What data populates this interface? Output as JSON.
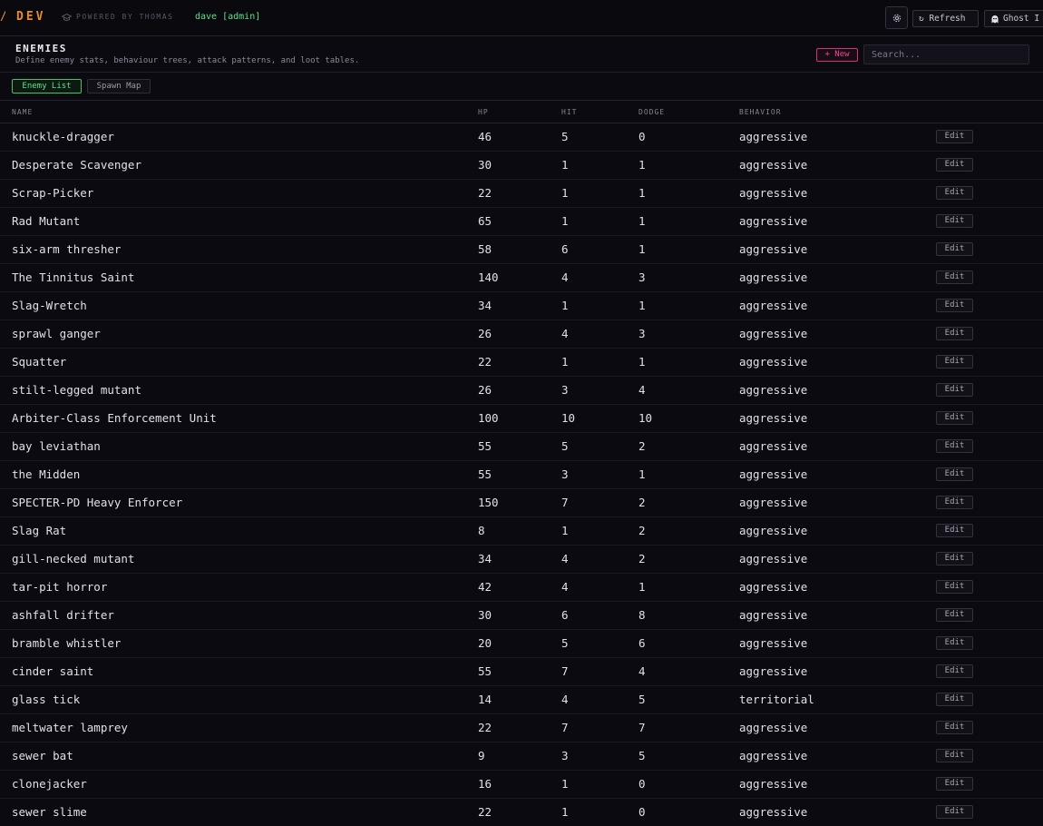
{
  "topbar": {
    "logo_mark": "/",
    "brand": "DEV",
    "powered_by": "POWERED BY THOMAS",
    "user": "dave [admin]",
    "refresh_label": "↻ Refresh",
    "ghost_label": "Ghost I"
  },
  "section": {
    "title": "ENEMIES",
    "description": "Define enemy stats, behaviour trees, attack patterns, and loot tables.",
    "new_label": "+ New",
    "search_placeholder": "Search..."
  },
  "tabs": [
    {
      "label": "Enemy List",
      "active": true
    },
    {
      "label": "Spawn Map",
      "active": false
    }
  ],
  "table": {
    "columns": [
      "NAME",
      "HP",
      "HIT",
      "DODGE",
      "BEHAVIOR"
    ],
    "edit_label": "Edit",
    "rows": [
      {
        "name": "knuckle-dragger",
        "hp": "46",
        "hit": "5",
        "dodge": "0",
        "behavior": "aggressive"
      },
      {
        "name": "Desperate Scavenger",
        "hp": "30",
        "hit": "1",
        "dodge": "1",
        "behavior": "aggressive"
      },
      {
        "name": "Scrap-Picker",
        "hp": "22",
        "hit": "1",
        "dodge": "1",
        "behavior": "aggressive"
      },
      {
        "name": "Rad Mutant",
        "hp": "65",
        "hit": "1",
        "dodge": "1",
        "behavior": "aggressive"
      },
      {
        "name": "six-arm thresher",
        "hp": "58",
        "hit": "6",
        "dodge": "1",
        "behavior": "aggressive"
      },
      {
        "name": "The Tinnitus Saint",
        "hp": "140",
        "hit": "4",
        "dodge": "3",
        "behavior": "aggressive"
      },
      {
        "name": "Slag-Wretch",
        "hp": "34",
        "hit": "1",
        "dodge": "1",
        "behavior": "aggressive"
      },
      {
        "name": "sprawl ganger",
        "hp": "26",
        "hit": "4",
        "dodge": "3",
        "behavior": "aggressive"
      },
      {
        "name": "Squatter",
        "hp": "22",
        "hit": "1",
        "dodge": "1",
        "behavior": "aggressive"
      },
      {
        "name": "stilt-legged mutant",
        "hp": "26",
        "hit": "3",
        "dodge": "4",
        "behavior": "aggressive"
      },
      {
        "name": "Arbiter-Class Enforcement Unit",
        "hp": "100",
        "hit": "10",
        "dodge": "10",
        "behavior": "aggressive"
      },
      {
        "name": "bay leviathan",
        "hp": "55",
        "hit": "5",
        "dodge": "2",
        "behavior": "aggressive"
      },
      {
        "name": "the Midden",
        "hp": "55",
        "hit": "3",
        "dodge": "1",
        "behavior": "aggressive"
      },
      {
        "name": "SPECTER-PD Heavy Enforcer",
        "hp": "150",
        "hit": "7",
        "dodge": "2",
        "behavior": "aggressive"
      },
      {
        "name": "Slag Rat",
        "hp": "8",
        "hit": "1",
        "dodge": "2",
        "behavior": "aggressive"
      },
      {
        "name": "gill-necked mutant",
        "hp": "34",
        "hit": "4",
        "dodge": "2",
        "behavior": "aggressive"
      },
      {
        "name": "tar-pit horror",
        "hp": "42",
        "hit": "4",
        "dodge": "1",
        "behavior": "aggressive"
      },
      {
        "name": "ashfall drifter",
        "hp": "30",
        "hit": "6",
        "dodge": "8",
        "behavior": "aggressive"
      },
      {
        "name": "bramble whistler",
        "hp": "20",
        "hit": "5",
        "dodge": "6",
        "behavior": "aggressive"
      },
      {
        "name": "cinder saint",
        "hp": "55",
        "hit": "7",
        "dodge": "4",
        "behavior": "aggressive"
      },
      {
        "name": "glass tick",
        "hp": "14",
        "hit": "4",
        "dodge": "5",
        "behavior": "territorial"
      },
      {
        "name": "meltwater lamprey",
        "hp": "22",
        "hit": "7",
        "dodge": "7",
        "behavior": "aggressive"
      },
      {
        "name": "sewer bat",
        "hp": "9",
        "hit": "3",
        "dodge": "5",
        "behavior": "aggressive"
      },
      {
        "name": "clonejacker",
        "hp": "16",
        "hit": "1",
        "dodge": "0",
        "behavior": "aggressive"
      },
      {
        "name": "sewer slime",
        "hp": "22",
        "hit": "1",
        "dodge": "0",
        "behavior": "aggressive"
      }
    ]
  },
  "colors": {
    "brand": "#e8892d",
    "user": "#5ee08a",
    "new_button": "#e8489b",
    "active_tab": "#5ee08a",
    "background": "#0b0a10"
  },
  "icons": {
    "powered": "cap-icon",
    "settings": "gear-icon",
    "ghost": "ghost-icon"
  }
}
